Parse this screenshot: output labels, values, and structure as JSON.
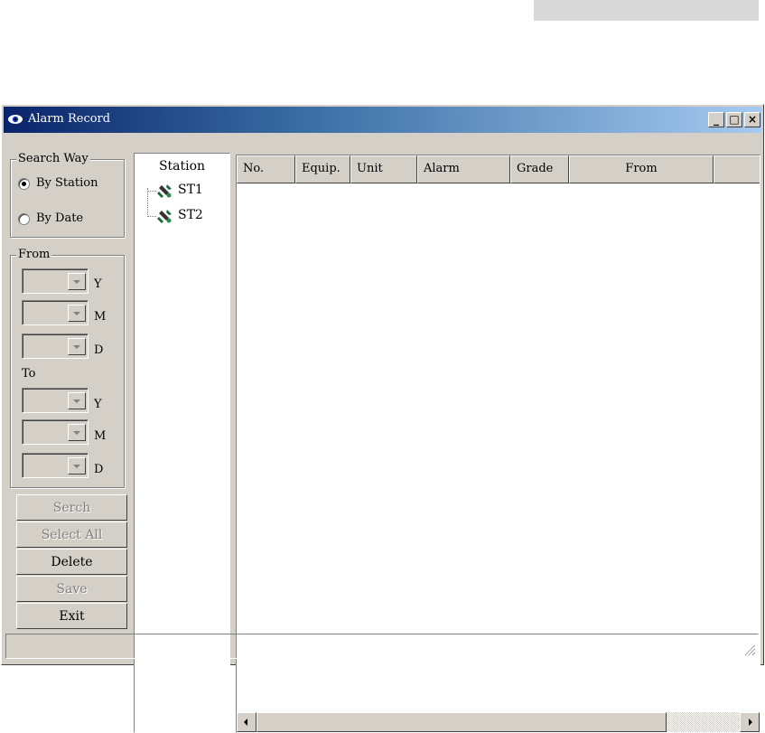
{
  "window": {
    "title": "Alarm Record",
    "controls": {
      "minimize": "_",
      "maximize": "□",
      "close": "×"
    }
  },
  "search_way": {
    "legend": "Search Way",
    "options": [
      {
        "label": "By Station",
        "selected": true
      },
      {
        "label": "By Date",
        "selected": false
      }
    ]
  },
  "date_range": {
    "from_legend": "From",
    "to_label": "To",
    "from_fields": [
      {
        "unit": "Y",
        "value": ""
      },
      {
        "unit": "M",
        "value": ""
      },
      {
        "unit": "D",
        "value": ""
      }
    ],
    "to_fields": [
      {
        "unit": "Y",
        "value": ""
      },
      {
        "unit": "M",
        "value": ""
      },
      {
        "unit": "D",
        "value": ""
      }
    ]
  },
  "buttons": {
    "search": {
      "label": "Serch",
      "enabled": false
    },
    "select_all": {
      "label": "Select All",
      "enabled": false
    },
    "delete": {
      "label": "Delete",
      "enabled": true
    },
    "save": {
      "label": "Save",
      "enabled": false
    },
    "exit": {
      "label": "Exit",
      "enabled": true
    }
  },
  "station_tree": {
    "header": "Station",
    "items": [
      {
        "label": "ST1",
        "icon": "satellite-icon"
      },
      {
        "label": "ST2",
        "icon": "satellite-icon"
      }
    ]
  },
  "alarm_table": {
    "columns": [
      "No.",
      "Equip.",
      "Unit",
      "Alarm",
      "Grade",
      "From",
      ""
    ],
    "rows": []
  },
  "status_bar": {
    "text": ""
  },
  "colors": {
    "window_face": "#d4d0c8",
    "title_start": "#0a246a",
    "title_end": "#a6caf0",
    "disabled_text": "#808080"
  }
}
